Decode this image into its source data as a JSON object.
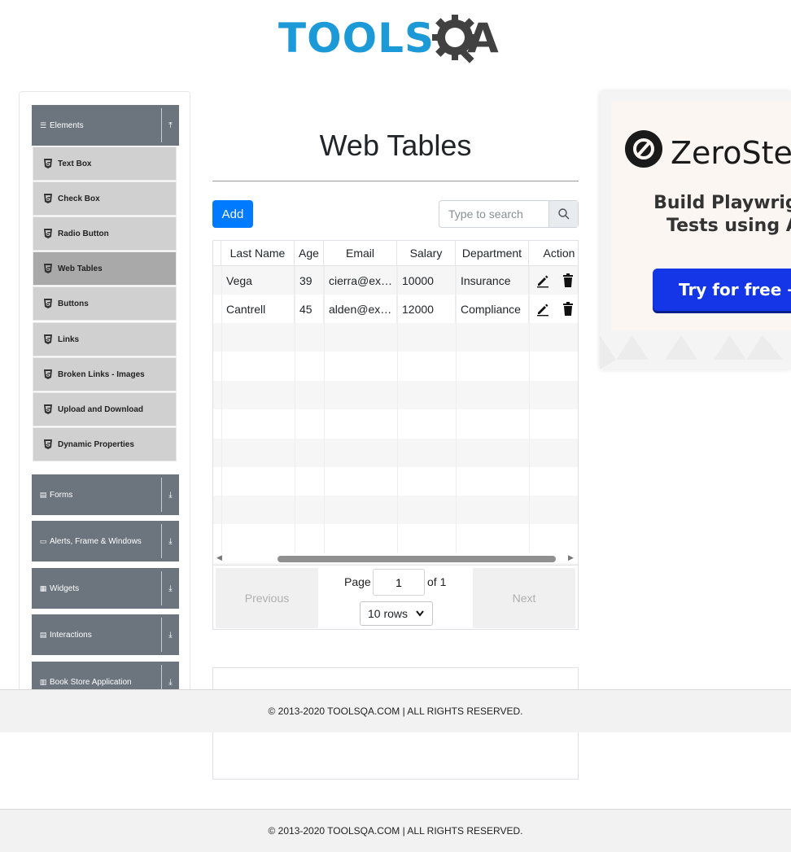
{
  "header": {
    "logo_primary": "TOOLS",
    "logo_secondary": "QA"
  },
  "sidebar": {
    "elements_group": {
      "title": "Elements",
      "icon": "hamburger-icon",
      "toggle_icon": "arrow-up-icon"
    },
    "elements_items": [
      {
        "label": "Text Box",
        "icon": "html5-icon"
      },
      {
        "label": "Check Box",
        "icon": "html5-icon"
      },
      {
        "label": "Radio Button",
        "icon": "html5-icon"
      },
      {
        "label": "Web Tables",
        "icon": "html5-icon",
        "active": true
      },
      {
        "label": "Buttons",
        "icon": "html5-icon"
      },
      {
        "label": "Links",
        "icon": "html5-icon"
      },
      {
        "label": "Broken Links - Images",
        "icon": "html5-icon"
      },
      {
        "label": "Upload and Download",
        "icon": "html5-icon"
      },
      {
        "label": "Dynamic Properties",
        "icon": "html5-icon"
      }
    ],
    "groups": [
      {
        "title": "Forms",
        "icon": "form-icon",
        "toggle_icon": "arrow-down-icon"
      },
      {
        "title": "Alerts, Frame & Windows",
        "icon": "window-icon",
        "toggle_icon": "arrow-down-icon"
      },
      {
        "title": "Widgets",
        "icon": "grid-icon",
        "toggle_icon": "arrow-down-icon"
      },
      {
        "title": "Interactions",
        "icon": "list-icon",
        "toggle_icon": "arrow-down-icon"
      },
      {
        "title": "Book Store Application",
        "icon": "books-icon",
        "toggle_icon": "arrow-down-icon"
      }
    ]
  },
  "main": {
    "title": "Web Tables",
    "add_label": "Add",
    "search": {
      "placeholder": "Type to search",
      "value": ""
    },
    "table": {
      "headers": [
        "Last Name",
        "Age",
        "Email",
        "Salary",
        "Department",
        "Action"
      ],
      "rows": [
        {
          "last_name": "Vega",
          "age": "39",
          "email": "cierra@ex…",
          "salary": "10000",
          "department": "Insurance"
        },
        {
          "last_name": "Cantrell",
          "age": "45",
          "email": "alden@ex…",
          "salary": "12000",
          "department": "Compliance"
        }
      ]
    },
    "pagination": {
      "previous": "Previous",
      "next": "Next",
      "page_label": "Page",
      "page_value": "1",
      "of_label": "of 1",
      "rows_option": "10 rows"
    }
  },
  "footer": {
    "text": "© 2013-2020 TOOLSQA.COM | ALL RIGHTS RESERVED."
  },
  "ad": {
    "brand": "ZeroSte",
    "tagline_line1": "Build Playwright",
    "tagline_line2": "Tests using AI",
    "cta": "Try for free →"
  },
  "colors": {
    "accent": "#007bff",
    "sidebar_header": "#6c757d",
    "logo_blue": "#1b9ad7",
    "ad_cta": "#1436e6"
  }
}
